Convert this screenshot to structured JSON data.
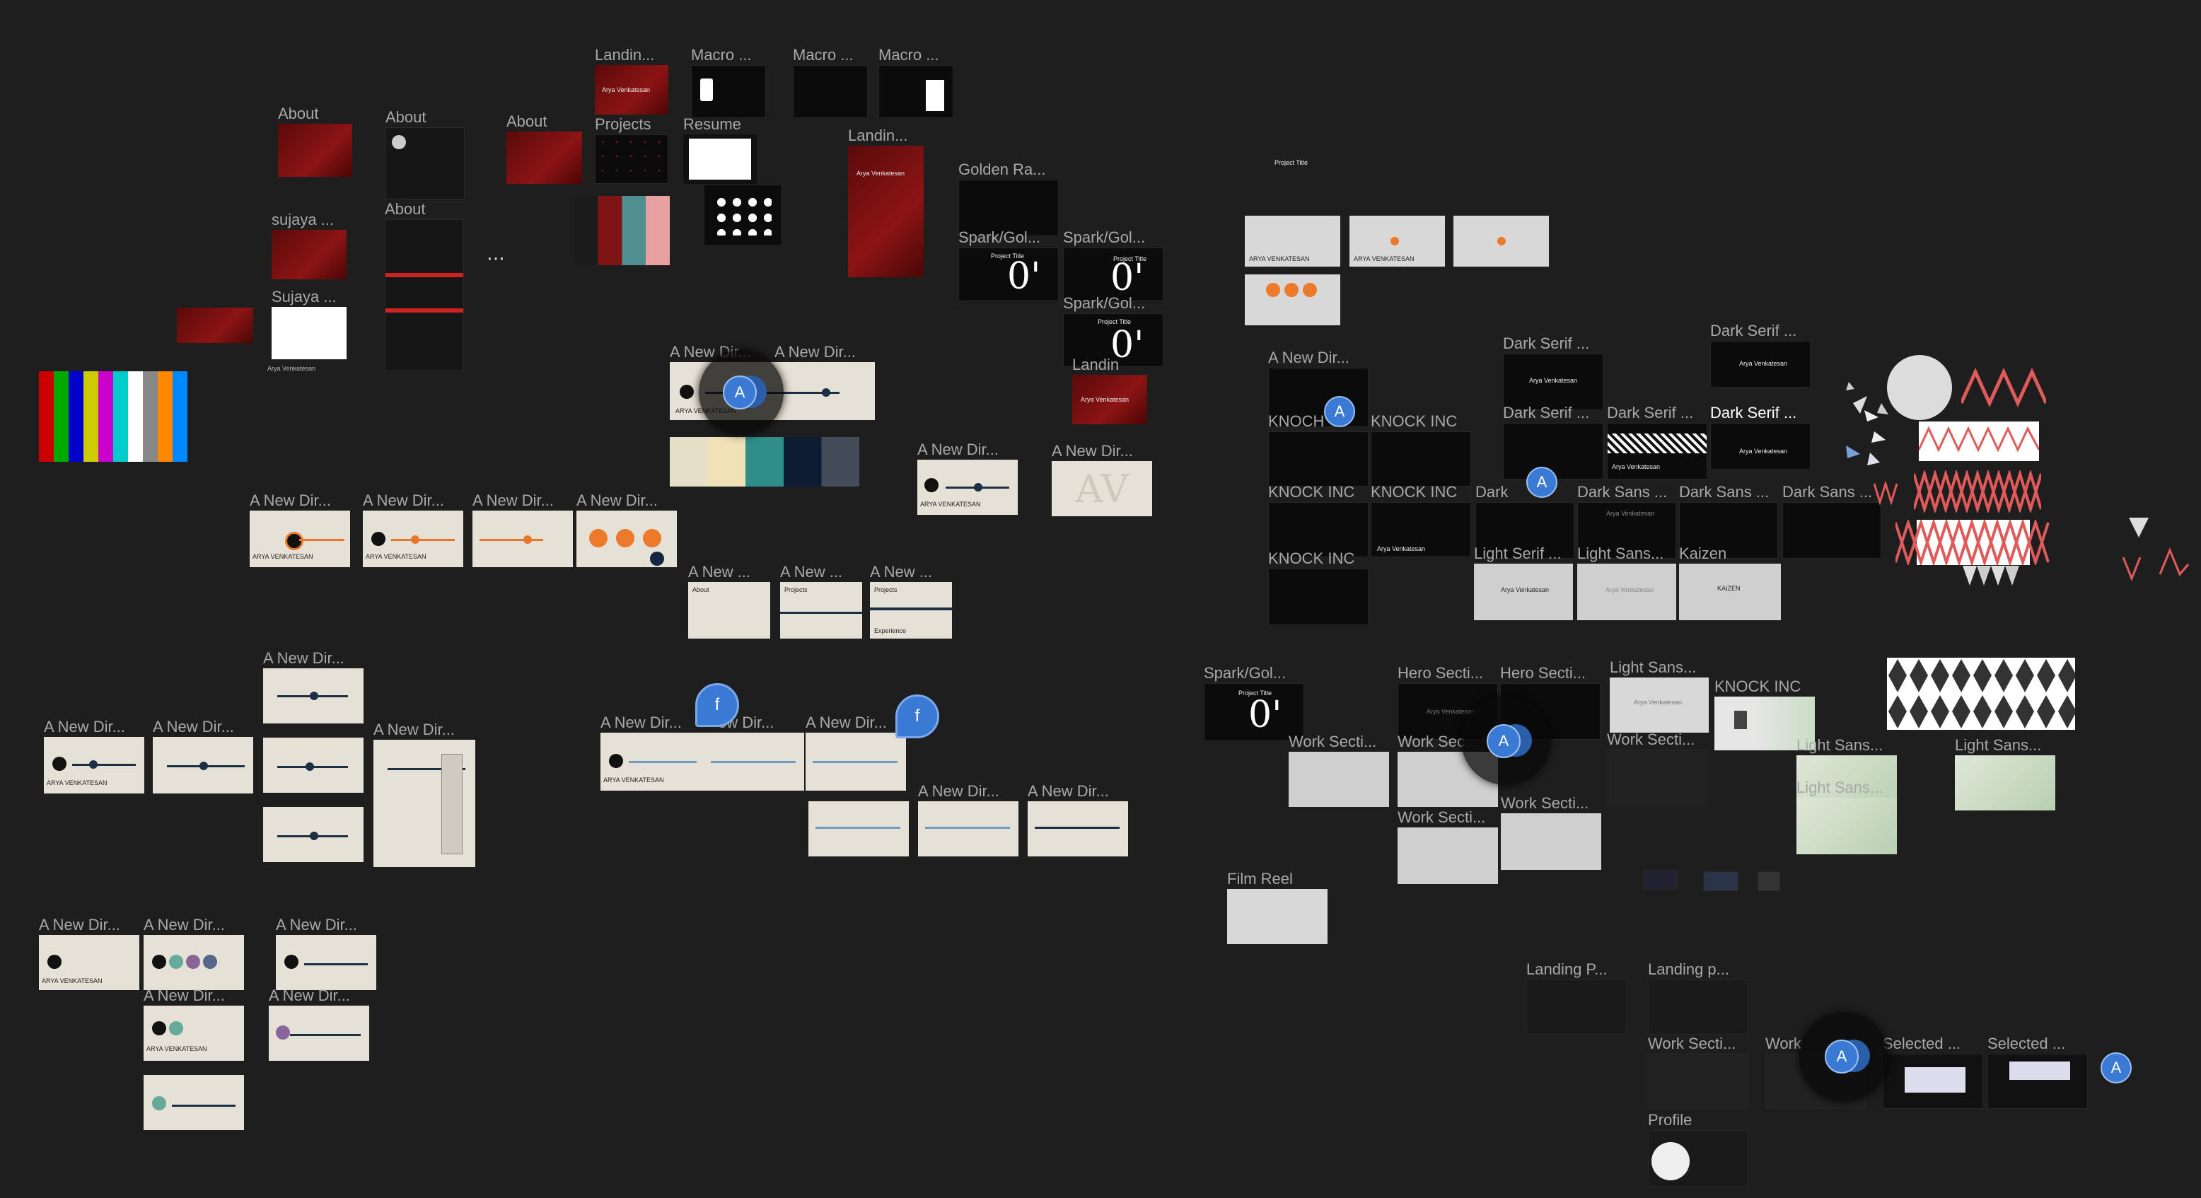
{
  "canvas": {
    "background": "#1e1e1e",
    "accent": "#3a7ad5",
    "orange": "#ec7a2a"
  },
  "frames": {
    "about_1": "About",
    "about_2": "About",
    "about_3": "About",
    "about_4": "About",
    "sujaya_1": "sujaya ...",
    "sujaya_2": "Sujaya ...",
    "sujaya_caption": "Arya Venkatesan",
    "landing_1": "Landin...",
    "landing_2": "Landin...",
    "landing_3": "Landin",
    "macro_1": "Macro ...",
    "macro_2": "Macro ...",
    "macro_3": "Macro ...",
    "projects": "Projects",
    "resume": "Resume",
    "golden": "Golden Ra...",
    "spark_1": "Spark/Gol...",
    "spark_2": "Spark/Gol...",
    "spark_3": "Spark/Gol...",
    "spark_4": "Spark/Gol...",
    "new_dir": "A New Dir...",
    "new_short": "A New ...",
    "new_ew": "ew Dir...",
    "new_n_dir": "A New Dir..",
    "dark_serif": "Dark Serif ...",
    "dark_sans": "Dark Sans ...",
    "dark_cut": "Dark",
    "light_serif": "Light Serif ...",
    "light_sans_1": "Light Sans...",
    "light_sans_2": "Light Sans...",
    "light_sans_3": "Light Sans...",
    "light_sans_4": "Light Sans...",
    "kaizen": "Kaizen",
    "knock": "KNOCK INC",
    "knock_cut": "KNOCH",
    "hero": "Hero Secti...",
    "work": "Work Secti...",
    "work_sec": "Work Sec",
    "work_cut": "Work",
    "film_reel": "Film Reel",
    "landing_p1": "Landing P...",
    "landing_p2": "Landing p...",
    "selected": "Selected ...",
    "profile": "Profile"
  },
  "mini_text": {
    "name_caps": "ARYA VENKATESAN",
    "name": "Arya Venkatesan",
    "project_title": "Project Title",
    "zero": "0'",
    "about": "About",
    "projects": "Projects",
    "experience": "Experience",
    "av": "AV",
    "kaizen": "KAIZEN"
  },
  "cursors": {
    "a": "A",
    "f": "f"
  }
}
